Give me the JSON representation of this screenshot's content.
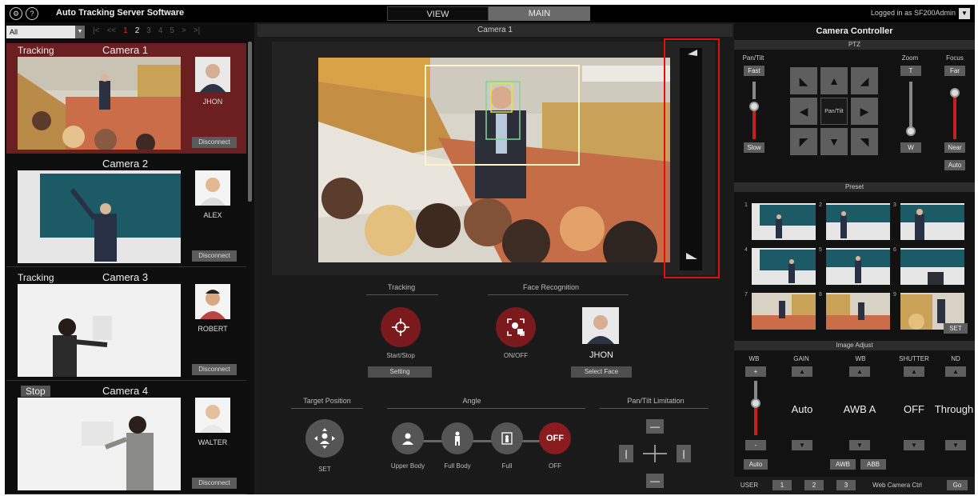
{
  "app": {
    "title": "Auto Tracking Server Software",
    "nav": {
      "view": "VIEW",
      "main": "MAIN"
    },
    "login_text": "Logged in as SF200Admin",
    "login_dropdown": "▼"
  },
  "camera_list": {
    "filter_value": "All",
    "pager": [
      "|<",
      "<<",
      "1",
      "2",
      "3",
      "4",
      "5",
      ">",
      ">|"
    ],
    "current_page": "2",
    "cameras": [
      {
        "status": "Tracking",
        "name": "Camera 1",
        "face_name": "JHON",
        "disconnect": "Disconnect"
      },
      {
        "status": "",
        "name": "Camera 2",
        "face_name": "ALEX",
        "disconnect": "Disconnect"
      },
      {
        "status": "Tracking",
        "name": "Camera 3",
        "face_name": "ROBERT",
        "disconnect": "Disconnect"
      },
      {
        "status": "Stop",
        "name": "Camera 4",
        "face_name": "WALTER",
        "disconnect": "Disconnect"
      }
    ]
  },
  "main_view": {
    "title": "Camera 1",
    "tracking": {
      "label": "Tracking",
      "button": "Start/Stop",
      "setting": "Setting"
    },
    "face_recognition": {
      "label": "Face Recognition",
      "button": "ON/OFF",
      "face_name": "JHON",
      "select": "Select Face"
    },
    "target_position": {
      "label": "Target Position",
      "button": "SET"
    },
    "angle": {
      "label": "Angle",
      "options": [
        "Upper Body",
        "Full Body",
        "Full",
        "OFF"
      ],
      "off_text": "OFF"
    },
    "pan_tilt_limitation": {
      "label": "Pan/Tilt Limitation"
    }
  },
  "controller": {
    "title": "Camera Controller",
    "ptz": {
      "label": "PTZ",
      "pan_tilt": "Pan/Tilt",
      "fast": "Fast",
      "slow": "Slow",
      "center": "Pan/Tilt",
      "zoom": "Zoom",
      "zoom_t": "T",
      "zoom_w": "W",
      "focus": "Focus",
      "far": "Far",
      "near": "Near",
      "auto": "Auto"
    },
    "preset": {
      "label": "Preset",
      "numbers": [
        "1",
        "2",
        "3",
        "4",
        "5",
        "6",
        "7",
        "8",
        "9"
      ],
      "set": "SET"
    },
    "image_adjust": {
      "label": "Image Adjust",
      "wb_left": "WB",
      "gain": "GAIN",
      "wb": "WB",
      "shutter": "SHUTTER",
      "nd": "ND",
      "plus": "+",
      "minus": "-",
      "gain_value": "Auto",
      "wb_value": "AWB A",
      "shutter_value": "OFF",
      "nd_value": "Through",
      "auto": "Auto",
      "awb": "AWB",
      "abb": "ABB"
    },
    "user": {
      "label": "USER",
      "buttons": [
        "1",
        "2",
        "3"
      ],
      "web_ctrl": "Web Camera Ctrl",
      "go": "Go"
    }
  }
}
